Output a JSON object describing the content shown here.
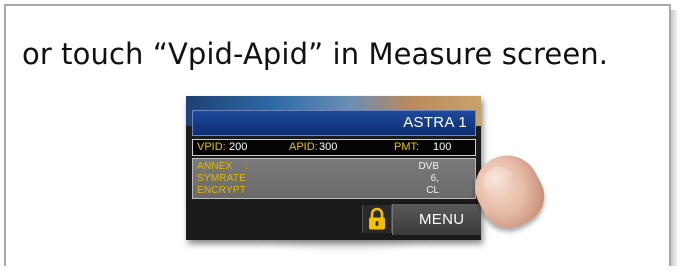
{
  "caption": "or touch “Vpid-Apid” in Measure screen.",
  "device": {
    "satellite_name": "ASTRA 1",
    "pids": {
      "vpid_label": "VPID:",
      "vpid_value": "200",
      "apid_label": "APID:",
      "apid_value": "300",
      "pmt_label": "PMT:",
      "pmt_value": "100"
    },
    "info": [
      {
        "label": "ANNEX",
        "value": "DVB"
      },
      {
        "label": "SYMRATE",
        "value": "6,"
      },
      {
        "label": "ENCRYPT",
        "value": "CL"
      }
    ],
    "menu_label": "MENU"
  },
  "colors": {
    "frame_border": "#a9a9a9",
    "accent_yellow": "#e8c400",
    "satellite_bar": "#1e4a9a"
  },
  "icons": {
    "lock": "padlock-icon"
  }
}
